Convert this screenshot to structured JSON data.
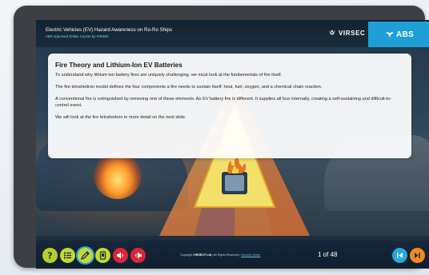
{
  "header": {
    "title": "Electric Vehicles (EV) Hazard Awareness on Ro-Ro Ships",
    "subtitle": "ABS Approved Online Course by VIRSEC",
    "logo_virsec": "VIRSEC",
    "logo_abs": "ABS"
  },
  "slide": {
    "title": "Fire Theory and Lithium-Ion EV Batteries",
    "paragraphs": [
      "To understand why lithium-ion battery fires are uniquely challenging, we must look at the fundamentals of fire itself.",
      "The fire tetrahedron model defines the four components a fire needs to sustain itself: heat, fuel, oxygen, and a chemical chain reaction.",
      "A conventional fire is extinguished by removing one of these elements. An EV battery fire is different. It supplies all four internally, creating a self-sustaining and difficult-to-control event.",
      "We will look at the fire tetrahedron in more detail on the next slide."
    ]
  },
  "footer": {
    "copyright_prefix": "Copyright",
    "copyright_company": "VIRSEC® Ltd",
    "copyright_suffix": "| All Rights Reserved |",
    "security_link": "Security Notice",
    "page_counter": "1 of 48"
  },
  "icons": {
    "help": "help-icon",
    "menu": "menu-list-icon",
    "notes": "pencil-icon",
    "glossary": "book-icon",
    "audio_off": "speaker-mute-icon",
    "audio_on": "speaker-icon",
    "prev": "previous-icon",
    "next": "next-icon"
  },
  "colors": {
    "header_bg": "#132231",
    "abs_blue": "#1f9fd8",
    "button_green": "#c3d934",
    "button_red": "#d8273a",
    "prev_blue": "#29a6de",
    "next_orange": "#f28b1a",
    "subtitle_cyan": "#7fd4e8"
  }
}
